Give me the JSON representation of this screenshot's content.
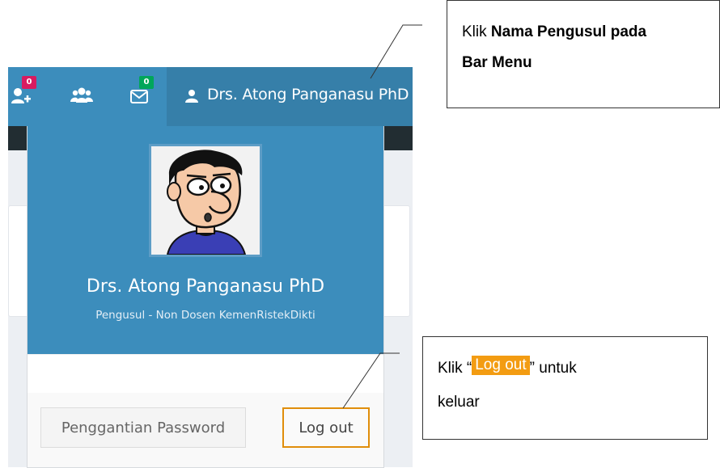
{
  "navbar": {
    "add_user_badge": "0",
    "mail_badge": "0",
    "user_name": "Drs. Atong Panganasu PhD",
    "icons": [
      "user-plus-icon",
      "users-icon",
      "envelope-icon",
      "user-icon"
    ]
  },
  "dropdown": {
    "name": "Drs. Atong Panganasu PhD",
    "role": "Pengusul - Non Dosen KemenRistekDikti",
    "change_password_label": "Penggantian Password",
    "logout_label": "Log out"
  },
  "callouts": {
    "top_prefix": "Klik ",
    "top_bold_line1": "Nama Pengusul pada",
    "top_bold_line2": "Bar Menu",
    "bottom_prefix": "Klik  “",
    "bottom_chip": "Log out",
    "bottom_suffix": "” untuk",
    "bottom_line2": "keluar"
  },
  "colors": {
    "navbar": "#3c8dbc",
    "navbar_active": "#367fa9",
    "logout_highlight": "#f39c12",
    "badge_pink": "#d81b60",
    "badge_green": "#00a65a"
  }
}
